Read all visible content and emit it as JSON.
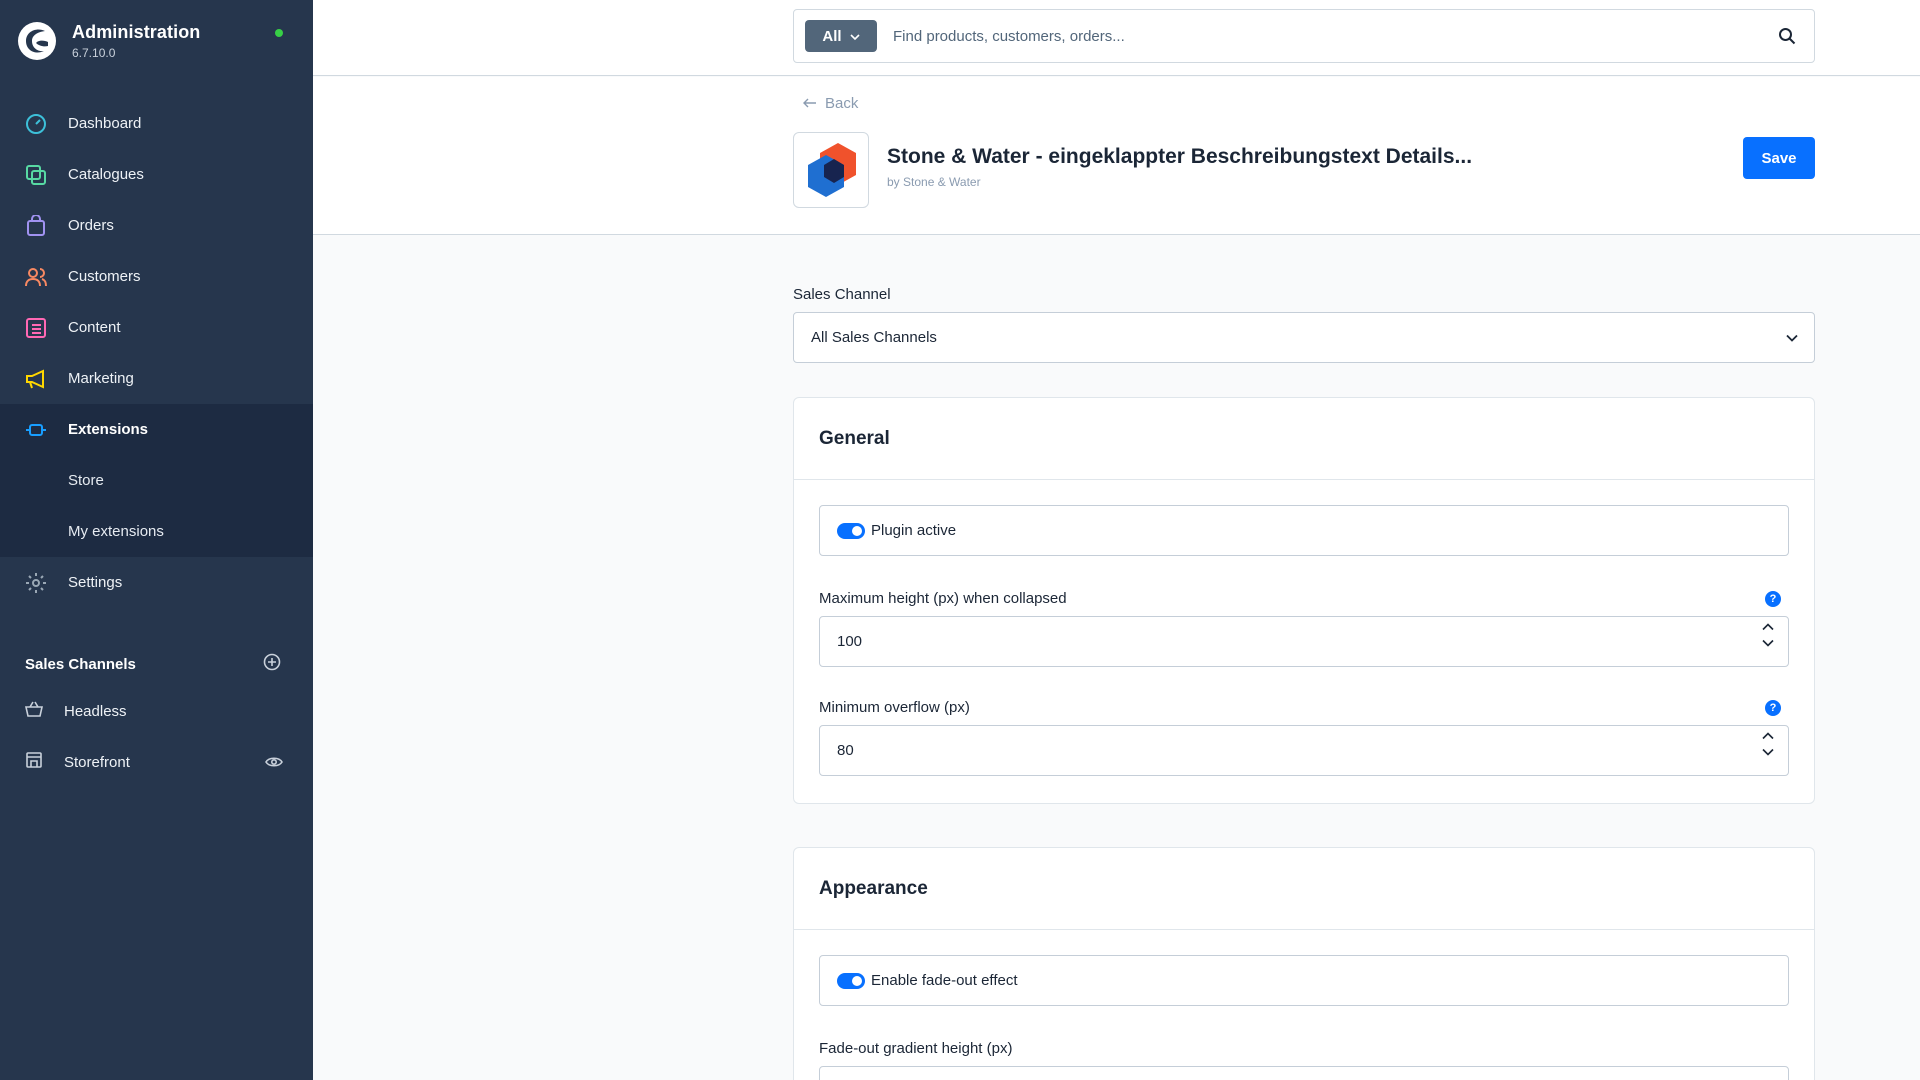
{
  "app": {
    "title": "Administration",
    "version": "6.7.10.0"
  },
  "sidebar": {
    "items": [
      {
        "label": "Dashboard",
        "icon": "dashboard-icon",
        "color": "#3dc0d9"
      },
      {
        "label": "Catalogues",
        "icon": "catalogues-icon",
        "color": "#57d9a3"
      },
      {
        "label": "Orders",
        "icon": "orders-icon",
        "color": "#a092f0"
      },
      {
        "label": "Customers",
        "icon": "customers-icon",
        "color": "#f88962"
      },
      {
        "label": "Content",
        "icon": "content-icon",
        "color": "#ff68b4"
      },
      {
        "label": "Marketing",
        "icon": "marketing-icon",
        "color": "#ffd700"
      },
      {
        "label": "Extensions",
        "icon": "extensions-icon",
        "color": "#189eff"
      },
      {
        "label": "Settings",
        "icon": "settings-icon",
        "color": "#9aa8b5"
      }
    ],
    "extension_sub": [
      "Store",
      "My extensions"
    ],
    "sales_channels_heading": "Sales Channels",
    "sales_channels": [
      {
        "label": "Headless",
        "icon": "basket-icon"
      },
      {
        "label": "Storefront",
        "icon": "storefront-icon"
      }
    ]
  },
  "search": {
    "type": "All",
    "placeholder": "Find products, customers, orders..."
  },
  "header": {
    "back": "Back",
    "title": "Stone & Water - eingeklappter Beschreibungstext Details...",
    "author": "by Stone & Water",
    "save": "Save"
  },
  "sales_channel": {
    "label": "Sales Channel",
    "value": "All Sales Channels"
  },
  "general": {
    "title": "General",
    "plugin_active": "Plugin active",
    "max_height_label": "Maximum height (px) when collapsed",
    "max_height_value": "100",
    "min_overflow_label": "Minimum overflow (px)",
    "min_overflow_value": "80"
  },
  "appearance": {
    "title": "Appearance",
    "fade_out": "Enable fade-out effect",
    "gradient_label": "Fade-out gradient height (px)"
  },
  "colors": {
    "sidebar_bg": "#26364d",
    "sidebar_active": "#1d2b42",
    "accent": "#0870ff",
    "status": "#37d046"
  }
}
